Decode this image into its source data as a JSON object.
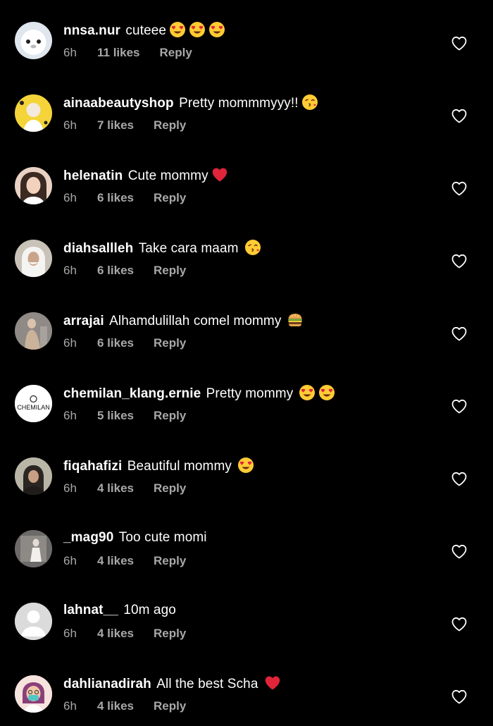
{
  "colors": {
    "background": "#000000",
    "text_primary": "#ffffff",
    "text_secondary": "#a8a8a8",
    "heart_red": "#e0243a",
    "emoji_yellow": "#ffcc33"
  },
  "comments": [
    {
      "username": "nnsa.nur",
      "text": "cuteee",
      "emojis": [
        "heart-eyes",
        "heart-eyes",
        "heart-eyes"
      ],
      "time": "6h",
      "likes": "11 likes",
      "reply": "Reply",
      "avatar": "white-fluffy-toy"
    },
    {
      "username": "ainaabeautyshop",
      "text": "Pretty mommmyyy!!",
      "emojis": [
        "kissing-heart"
      ],
      "time": "6h",
      "likes": "7 likes",
      "reply": "Reply",
      "avatar": "yellow-graphic"
    },
    {
      "username": "helenatin",
      "text": "Cute mommy",
      "emojis": [
        "red-heart"
      ],
      "time": "6h",
      "likes": "6 likes",
      "reply": "Reply",
      "avatar": "woman-portrait"
    },
    {
      "username": "diahsallleh",
      "text": "Take cara maam",
      "emojis": [
        "kissing-heart"
      ],
      "time": "6h",
      "likes": "6 likes",
      "reply": "Reply",
      "avatar": "person-white-hijab"
    },
    {
      "username": "arrajai",
      "text": "Alhamdulillah comel mommy",
      "emojis": [
        "burger"
      ],
      "time": "6h",
      "likes": "6 likes",
      "reply": "Reply",
      "avatar": "beige-outfit"
    },
    {
      "username": "chemilan_klang.ernie",
      "text": "Pretty mommy",
      "emojis": [
        "heart-eyes",
        "heart-eyes"
      ],
      "time": "6h",
      "likes": "5 likes",
      "reply": "Reply",
      "avatar": "chemilan-logo",
      "avatar_text": "CHEMILAN"
    },
    {
      "username": "fiqahafizi",
      "text": "Beautiful mommy",
      "emojis": [
        "heart-eyes"
      ],
      "time": "6h",
      "likes": "4 likes",
      "reply": "Reply",
      "avatar": "dark-portrait"
    },
    {
      "username": "_mag90",
      "text": "Too cute momi",
      "emojis": [],
      "time": "6h",
      "likes": "4 likes",
      "reply": "Reply",
      "avatar": "gray-photo"
    },
    {
      "username": "lahnat__",
      "text": "10m ago",
      "emojis": [],
      "time": "6h",
      "likes": "4 likes",
      "reply": "Reply",
      "avatar": "default-silhouette"
    },
    {
      "username": "dahlianadirah",
      "text": "All the best Scha",
      "emojis": [
        "red-heart"
      ],
      "time": "6h",
      "likes": "4 likes",
      "reply": "Reply",
      "avatar": "cartoon-mask"
    }
  ]
}
